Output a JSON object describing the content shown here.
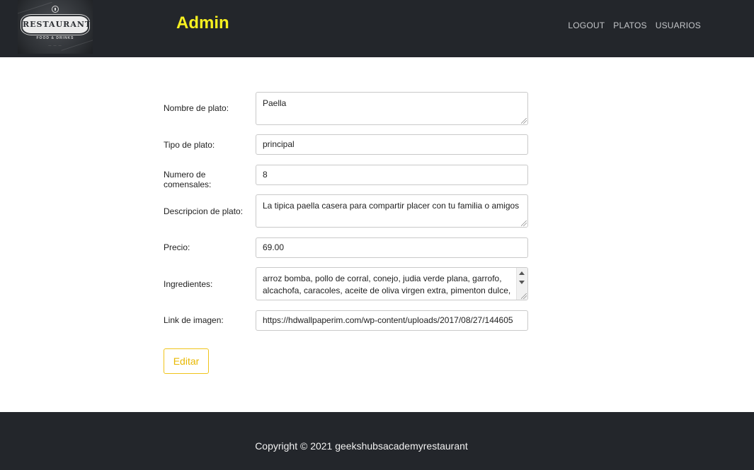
{
  "header": {
    "logo": {
      "banner_text": "RESTAURANT",
      "subtitle": "FOOD & DRINKS"
    },
    "title": "Admin",
    "nav": [
      {
        "label": "LOGOUT"
      },
      {
        "label": "PLATOS"
      },
      {
        "label": "USUARIOS"
      }
    ]
  },
  "form": {
    "fields": [
      {
        "label": "Nombre de plato:",
        "value": "Paella"
      },
      {
        "label": "Tipo de plato:",
        "value": "principal"
      },
      {
        "label": "Numero de comensales:",
        "value": "8"
      },
      {
        "label": "Descripcion de plato:",
        "value": "La tipica paella casera para compartir placer con tu familia o amigos"
      },
      {
        "label": "Precio:",
        "value": "69.00"
      },
      {
        "label": "Ingredientes:",
        "value": "arroz bomba, pollo de corral, conejo, judia verde plana, garrofo, alcachofa, caracoles, aceite de oliva virgen extra, pimenton dulce,"
      },
      {
        "label": "Link de imagen:",
        "value": "https://hdwallpaperim.com/wp-content/uploads/2017/08/27/144605"
      }
    ],
    "submit_label": "Editar"
  },
  "footer": {
    "copyright": "Copyright © 2021 geekshubsacademyrestaurant"
  },
  "colors": {
    "header_bg": "#23262b",
    "title_yellow": "#f7f01f",
    "button_accent": "#f0c419"
  }
}
